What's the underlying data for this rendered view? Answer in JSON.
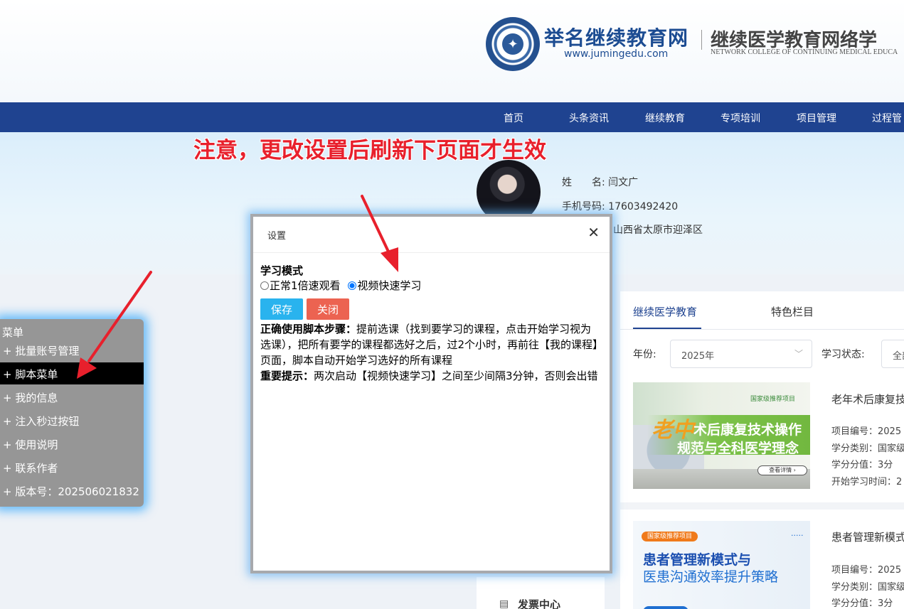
{
  "header": {
    "site_name": "举名继续教育网",
    "site_url": "www.jumingedu.com",
    "college_name": "继续医学教育网络学",
    "college_name_en": "NETWORK COLLEGE OF CONTINUING MEDICAL EDUCA"
  },
  "nav": {
    "items": [
      "首页",
      "头条资讯",
      "继续教育",
      "专项培训",
      "项目管理",
      "过程管"
    ]
  },
  "notice": "注意，更改设置后刷新下页面才生效",
  "profile": {
    "name_label": "姓　　名:",
    "name": "闫文广",
    "phone_label": "手机号码:",
    "phone": "17603492420",
    "address": "山西省太原市迎泽区"
  },
  "menu": {
    "title": "菜单",
    "items": [
      "+ 批量账号管理",
      "+ 脚本菜单",
      "+ 我的信息",
      "+ 注入秒过按钮",
      "+ 使用说明",
      "+ 联系作者",
      "+ 版本号：202506021832"
    ],
    "active_index": 1
  },
  "dialog": {
    "title": "设置",
    "close_glyph": "✕",
    "mode_title": "学习模式",
    "options": [
      "正常1倍速观看",
      "视频快速学习"
    ],
    "selected": "视频快速学习",
    "save_label": "保存",
    "close_label": "关闭",
    "steps_label": "正确使用脚本步骤：",
    "steps_text": "提前选课（找到要学习的课程，点击开始学习视为选课），把所有要学的课程都选好之后，过2个小时，再前往【我的课程】页面，脚本自动开始学习选好的所有课程",
    "tip_label": "重要提示：",
    "tip_text": "两次启动【视频快速学习】之间至少间隔3分钟，否则会出错"
  },
  "right_panel": {
    "tabs": [
      "继续医学教育",
      "特色栏目"
    ],
    "year_label": "年份:",
    "year_value": "2025年",
    "status_label": "学习状态:",
    "status_value": "全部",
    "courses": [
      {
        "img_tag": "国家级推荐项目",
        "img_line1_big": "老中",
        "img_line1": "术后康复技术操作",
        "img_line2": "规范与全科医学理念",
        "img_btn": "查看详情 ›",
        "title": "老年术后康复技",
        "code": "项目编号：2025",
        "type": "学分类别：国家级",
        "credit": "学分分值：3分",
        "start": "开始学习时间：2"
      },
      {
        "img_tag": "国家级推荐项目",
        "img_line1": "患者管理新模式与",
        "img_line2": "医患沟通效率提升策略",
        "title": "患者管理新模式",
        "code": "项目编号：2025",
        "type": "学分类别：国家级",
        "credit": "学分分值：3分"
      }
    ]
  },
  "invoice": "发票中心",
  "colors": {
    "nav_bg": "#1f4390",
    "notice_red": "#e8202c",
    "save_btn": "#29b3ee",
    "close_btn": "#ec6351",
    "menu_bg": "#969696",
    "glow": "#3caafa"
  }
}
